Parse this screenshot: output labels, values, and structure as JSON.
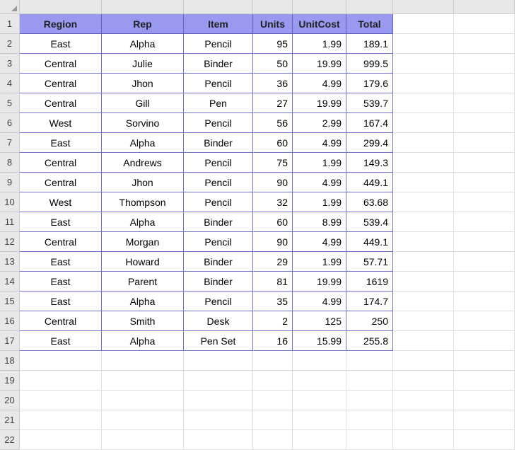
{
  "chart_data": {
    "type": "table",
    "title": "",
    "columns": [
      "Region",
      "Rep",
      "Item",
      "Units",
      "UnitCost",
      "Total"
    ],
    "rows": [
      [
        "East",
        "Alpha",
        "Pencil",
        95,
        1.99,
        189.1
      ],
      [
        "Central",
        "Julie",
        "Binder",
        50,
        19.99,
        999.5
      ],
      [
        "Central",
        "Jhon",
        "Pencil",
        36,
        4.99,
        179.6
      ],
      [
        "Central",
        "Gill",
        "Pen",
        27,
        19.99,
        539.7
      ],
      [
        "West",
        "Sorvino",
        "Pencil",
        56,
        2.99,
        167.4
      ],
      [
        "East",
        "Alpha",
        "Binder",
        60,
        4.99,
        299.4
      ],
      [
        "Central",
        "Andrews",
        "Pencil",
        75,
        1.99,
        149.3
      ],
      [
        "Central",
        "Jhon",
        "Pencil",
        90,
        4.99,
        449.1
      ],
      [
        "West",
        "Thompson",
        "Pencil",
        32,
        1.99,
        63.68
      ],
      [
        "East",
        "Alpha",
        "Binder",
        60,
        8.99,
        539.4
      ],
      [
        "Central",
        "Morgan",
        "Pencil",
        90,
        4.99,
        449.1
      ],
      [
        "East",
        "Howard",
        "Binder",
        29,
        1.99,
        57.71
      ],
      [
        "East",
        "Parent",
        "Binder",
        81,
        19.99,
        1619
      ],
      [
        "East",
        "Alpha",
        "Pencil",
        35,
        4.99,
        174.7
      ],
      [
        "Central",
        "Smith",
        "Desk",
        2,
        125,
        250
      ],
      [
        "East",
        "Alpha",
        "Pen Set",
        16,
        15.99,
        255.8
      ]
    ]
  },
  "grid": {
    "visible_row_start": 1,
    "visible_row_end": 22,
    "data_col_count": 6,
    "extra_col_count": 2,
    "empty_row_count": 5
  }
}
